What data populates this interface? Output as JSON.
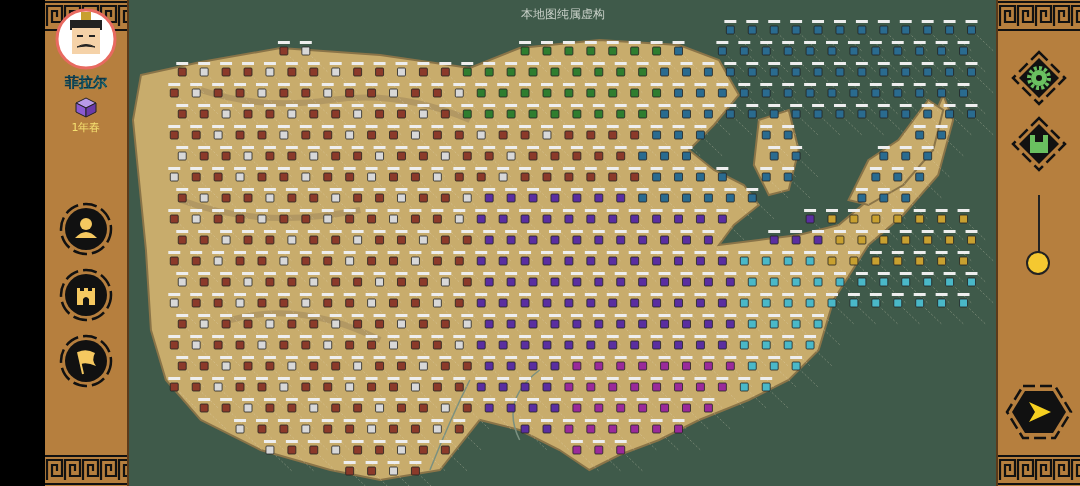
{
  "map": {
    "caption": "本地图纯属虚构"
  },
  "ruler": {
    "name": "菲拉尔",
    "date": "1年春"
  },
  "zoom_slider": {
    "level": 1
  }
}
